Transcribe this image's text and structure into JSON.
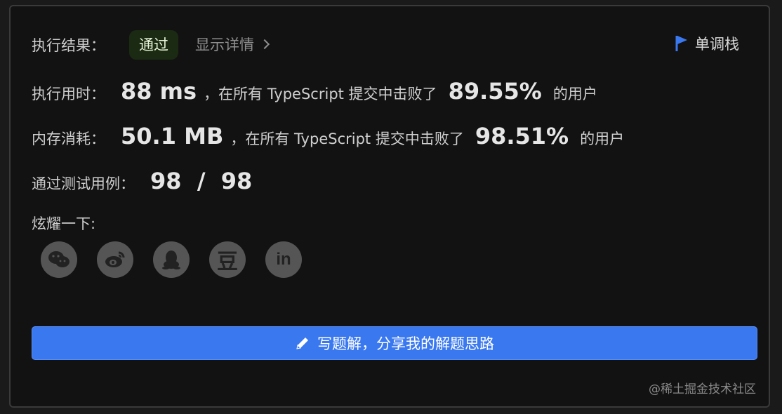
{
  "result": {
    "label": "执行结果：",
    "status": "通过",
    "detail_link": "显示详情",
    "debug_label": "单调栈"
  },
  "runtime": {
    "label": "执行用时：",
    "value": "88 ms",
    "mid_text": "，在所有 TypeScript 提交中击败了",
    "percent": "89.55%",
    "suffix": "的用户"
  },
  "memory": {
    "label": "内存消耗：",
    "value": "50.1 MB",
    "mid_text": "，在所有 TypeScript 提交中击败了",
    "percent": "98.51%",
    "suffix": "的用户"
  },
  "tests": {
    "label": "通过测试用例：",
    "value": "98  /  98"
  },
  "share": {
    "label": "炫耀一下:",
    "icons": [
      "wechat-icon",
      "weibo-icon",
      "qq-icon",
      "douban-icon",
      "linkedin-icon"
    ],
    "douban_glyph": "豆",
    "linkedin_glyph": "in"
  },
  "write_button": {
    "label": "写题解，分享我的解题思路"
  },
  "watermark": "@稀土掘金技术社区",
  "colors": {
    "accent": "#3a78f0",
    "panel_bg": "#121212",
    "badge_bg": "#1b2a13",
    "icon_bg": "#555555"
  }
}
